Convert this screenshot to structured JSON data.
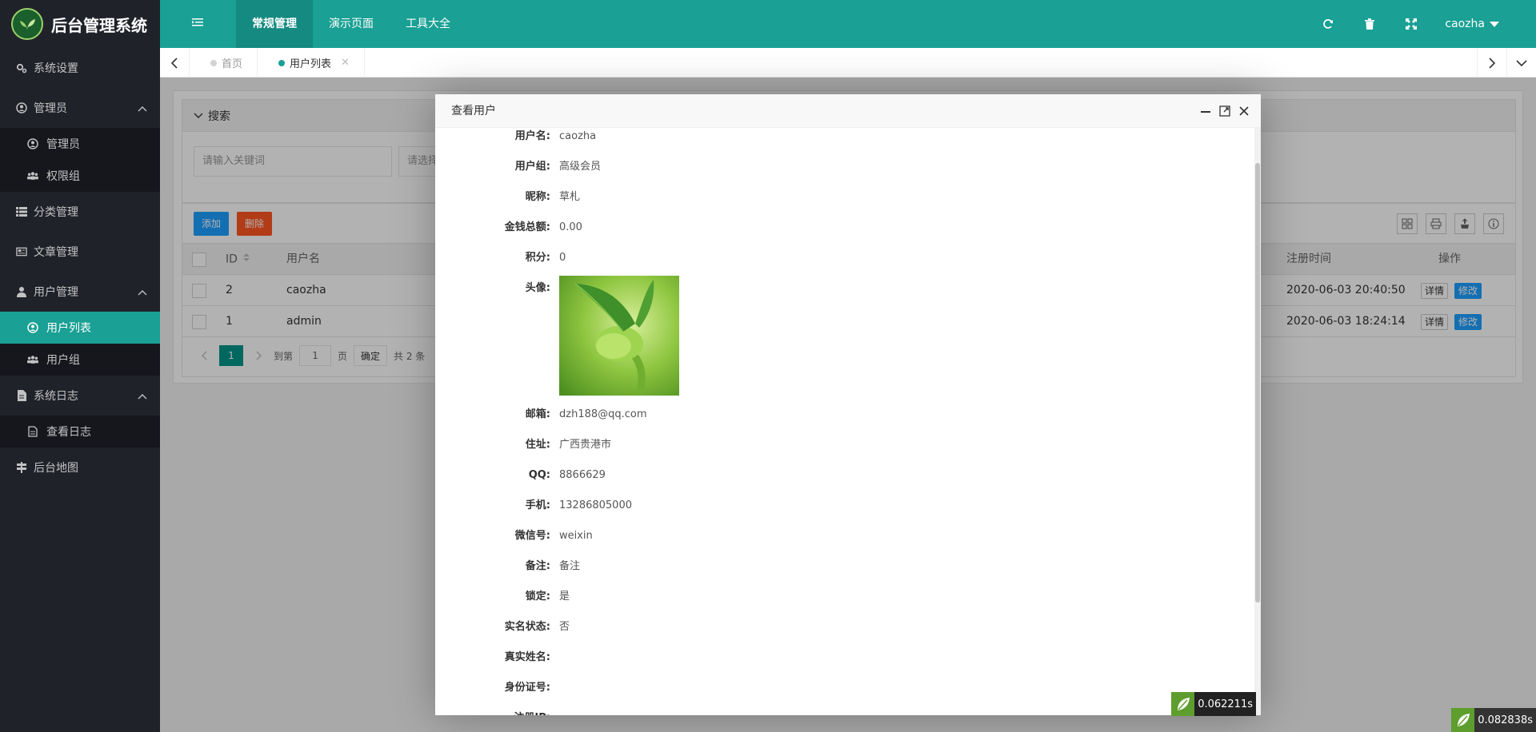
{
  "app": {
    "title": "后台管理系统"
  },
  "sidebar": {
    "items": [
      {
        "label": "系统设置",
        "icon": "gears-icon"
      },
      {
        "label": "管理员",
        "icon": "user-circle-icon",
        "children": [
          {
            "label": "管理员",
            "icon": "user-circle-icon"
          },
          {
            "label": "权限组",
            "icon": "users-icon"
          }
        ]
      },
      {
        "label": "分类管理",
        "icon": "list-icon"
      },
      {
        "label": "文章管理",
        "icon": "newspaper-icon"
      },
      {
        "label": "用户管理",
        "icon": "user-icon",
        "children": [
          {
            "label": "用户列表",
            "icon": "user-circle-icon",
            "active": true
          },
          {
            "label": "用户组",
            "icon": "users-icon"
          }
        ]
      },
      {
        "label": "系统日志",
        "icon": "file-icon",
        "children": [
          {
            "label": "查看日志",
            "icon": "file-text-icon"
          }
        ]
      },
      {
        "label": "后台地图",
        "icon": "map-signs-icon"
      }
    ]
  },
  "header": {
    "nav": [
      "常规管理",
      "演示页面",
      "工具大全"
    ],
    "user": "caozha"
  },
  "tabs": {
    "items": [
      {
        "label": "首页"
      },
      {
        "label": "用户列表",
        "active": true
      }
    ]
  },
  "search": {
    "title": "搜索",
    "keyword_placeholder": "请输入关键词",
    "select_placeholder": "请选择"
  },
  "toolbar": {
    "add_label": "添加",
    "delete_label": "删除"
  },
  "table": {
    "columns": {
      "id": "ID",
      "username": "用户名",
      "reg_time": "注册时间",
      "ops": "操作"
    },
    "rows": [
      {
        "id": "2",
        "username": "caozha",
        "reg_time": "2020-06-03 20:40:50"
      },
      {
        "id": "1",
        "username": "admin",
        "reg_time": "2020-06-03 18:24:14"
      }
    ],
    "detail_label": "详情",
    "edit_label": "修改"
  },
  "pager": {
    "current": "1",
    "goto_label": "到第",
    "page_input": "1",
    "page_label": "页",
    "ok_label": "确定",
    "total": "共 2 条"
  },
  "modal": {
    "title": "查看用户",
    "fields": [
      {
        "label": "用户名:",
        "value": "caozha"
      },
      {
        "label": "用户组:",
        "value": "高级会员"
      },
      {
        "label": "昵称:",
        "value": "草札"
      },
      {
        "label": "金钱总额:",
        "value": "0.00"
      },
      {
        "label": "积分:",
        "value": "0"
      },
      {
        "label": "头像:",
        "value": ""
      },
      {
        "label": "邮箱:",
        "value": "dzh188@qq.com"
      },
      {
        "label": "住址:",
        "value": "广西贵港市"
      },
      {
        "label": "QQ:",
        "value": "8866629"
      },
      {
        "label": "手机:",
        "value": "13286805000"
      },
      {
        "label": "微信号:",
        "value": "weixin"
      },
      {
        "label": "备注:",
        "value": "备注"
      },
      {
        "label": "锁定:",
        "value": "是"
      },
      {
        "label": "实名状态:",
        "value": "否"
      },
      {
        "label": "真实姓名:",
        "value": ""
      },
      {
        "label": "身份证号:",
        "value": ""
      },
      {
        "label": "注册IP:",
        "value": ""
      }
    ]
  },
  "timers": {
    "modal": "0.062211s",
    "page": "0.082838s"
  },
  "colors": {
    "theme": "#1aa094",
    "sidebar": "#20222a",
    "add": "#1e9fff",
    "delete": "#ff5722"
  }
}
